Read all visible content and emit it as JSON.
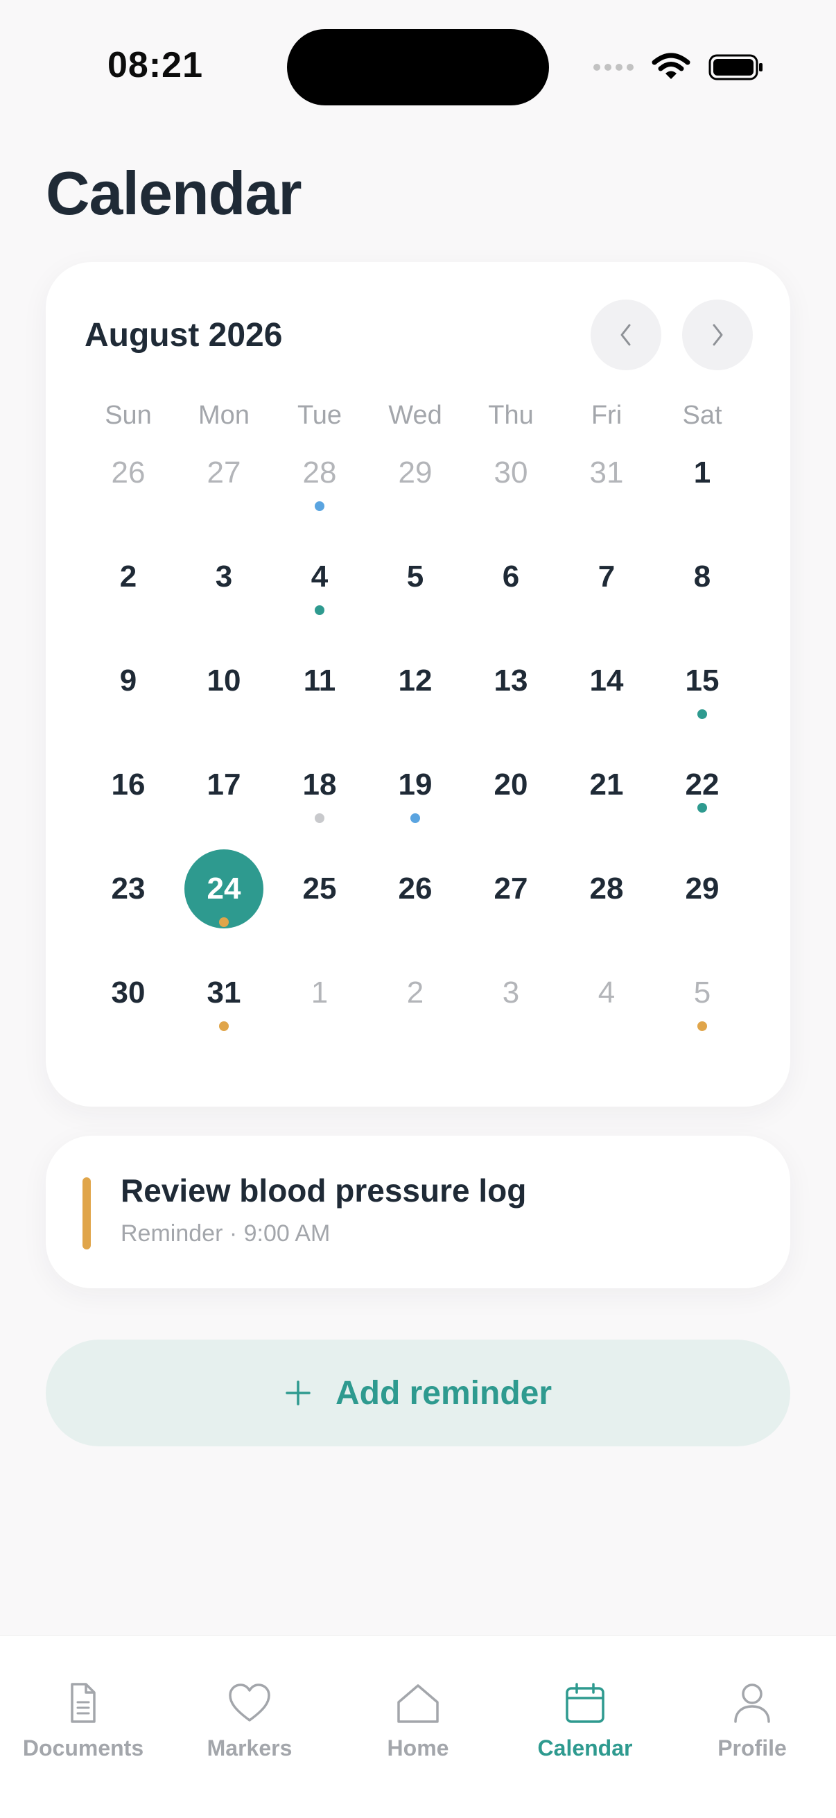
{
  "status_bar": {
    "time": "08:21"
  },
  "page": {
    "title": "Calendar"
  },
  "calendar": {
    "month_label": "August 2026",
    "weekdays": [
      "Sun",
      "Mon",
      "Tue",
      "Wed",
      "Thu",
      "Fri",
      "Sat"
    ],
    "days": [
      {
        "num": "26",
        "muted": true
      },
      {
        "num": "27",
        "muted": true
      },
      {
        "num": "28",
        "muted": true,
        "dot": "#5aa4e0"
      },
      {
        "num": "29",
        "muted": true
      },
      {
        "num": "30",
        "muted": true
      },
      {
        "num": "31",
        "muted": true
      },
      {
        "num": "1"
      },
      {
        "num": "2"
      },
      {
        "num": "3"
      },
      {
        "num": "4",
        "dot": "#2e9a8f"
      },
      {
        "num": "5"
      },
      {
        "num": "6"
      },
      {
        "num": "7"
      },
      {
        "num": "8"
      },
      {
        "num": "9"
      },
      {
        "num": "10"
      },
      {
        "num": "11"
      },
      {
        "num": "12"
      },
      {
        "num": "13"
      },
      {
        "num": "14"
      },
      {
        "num": "15",
        "dot": "#2e9a8f"
      },
      {
        "num": "16"
      },
      {
        "num": "17"
      },
      {
        "num": "18",
        "dot": "#c8c9cc"
      },
      {
        "num": "19",
        "dot": "#5aa4e0"
      },
      {
        "num": "20"
      },
      {
        "num": "21"
      },
      {
        "num": "22",
        "dot": "#2e9a8f",
        "tight": true
      },
      {
        "num": "23"
      },
      {
        "num": "24",
        "selected": true,
        "dot": "#e0a54a"
      },
      {
        "num": "25"
      },
      {
        "num": "26"
      },
      {
        "num": "27"
      },
      {
        "num": "28"
      },
      {
        "num": "29"
      },
      {
        "num": "30"
      },
      {
        "num": "31",
        "dot": "#e0a54a"
      },
      {
        "num": "1",
        "muted": true
      },
      {
        "num": "2",
        "muted": true
      },
      {
        "num": "3",
        "muted": true
      },
      {
        "num": "4",
        "muted": true
      },
      {
        "num": "5",
        "muted": true,
        "dot": "#e0a54a"
      }
    ]
  },
  "reminder": {
    "title": "Review blood pressure log",
    "subtitle": "Reminder · 9:00 AM",
    "accent": "#e0a54a"
  },
  "add_button": {
    "label": "Add reminder",
    "icon": "plus-icon"
  },
  "tabs": [
    {
      "label": "Documents",
      "icon": "document-icon",
      "active": false
    },
    {
      "label": "Markers",
      "icon": "heart-icon",
      "active": false
    },
    {
      "label": "Home",
      "icon": "home-icon",
      "active": false
    },
    {
      "label": "Calendar",
      "icon": "calendar-icon",
      "active": true
    },
    {
      "label": "Profile",
      "icon": "person-icon",
      "active": false
    }
  ],
  "colors": {
    "accent": "#2e9a8f",
    "muted": "#a3a6ab",
    "text": "#1f2a36"
  }
}
